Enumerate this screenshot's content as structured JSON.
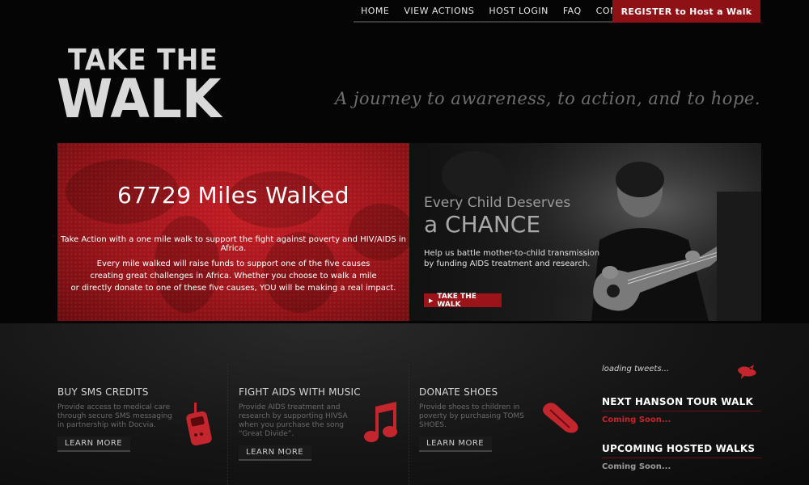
{
  "nav": {
    "items": [
      "HOME",
      "VIEW ACTIONS",
      "HOST LOGIN",
      "FAQ",
      "CONTACT"
    ],
    "register_label": "REGISTER to Host a Walk"
  },
  "logo": {
    "line1": "TAKE THE",
    "line2": "WALK"
  },
  "tagline": "A journey to awareness, to action, and to hope.",
  "hero_left": {
    "miles_count": "67729",
    "miles_label": "Miles Walked",
    "paragraph1": "Take Action with a one mile walk to support the fight against poverty and HIV/AIDS in Africa.",
    "paragraph2_lines": [
      "Every mile walked will raise funds to support one of the five causes",
      "creating great challenges in Africa. Whether you choose to walk a mile",
      "or directly donate to one of these five causes, YOU will be making a real impact."
    ]
  },
  "hero_right": {
    "headline1": "Every Child Deserves",
    "headline2": "a CHANCE",
    "body": "Help us battle mother-to-child transmission by funding AIDS treatment and research.",
    "button_label": "TAKE THE WALK"
  },
  "features": [
    {
      "title": "BUY SMS CREDITS",
      "description": "Provide access to medical care through secure SMS messaging in partnership with Docvia.",
      "button_label": "LEARN MORE",
      "icon": "cellphone-icon"
    },
    {
      "title": "FIGHT AIDS WITH MUSIC",
      "description": "Provide AIDS treatment and research by supporting HIVSA when you purchase the song “Great Divide”.",
      "button_label": "LEARN MORE",
      "icon": "music-note-icon"
    },
    {
      "title": "DONATE SHOES",
      "description": "Provide shoes to children in poverty by purchasing TOMS SHOES.",
      "button_label": "LEARN MORE",
      "icon": "shoe-icon"
    }
  ],
  "sidebar": {
    "tweets_status": "loading tweets...",
    "section1_title": "NEXT HANSON TOUR WALK",
    "section1_status": "Coming Soon...",
    "section2_title": "UPCOMING HOSTED WALKS",
    "section2_status": "Coming Soon..."
  },
  "colors": {
    "accent_red": "#9a1419",
    "status_red": "#c4262d",
    "background": "#050505"
  }
}
